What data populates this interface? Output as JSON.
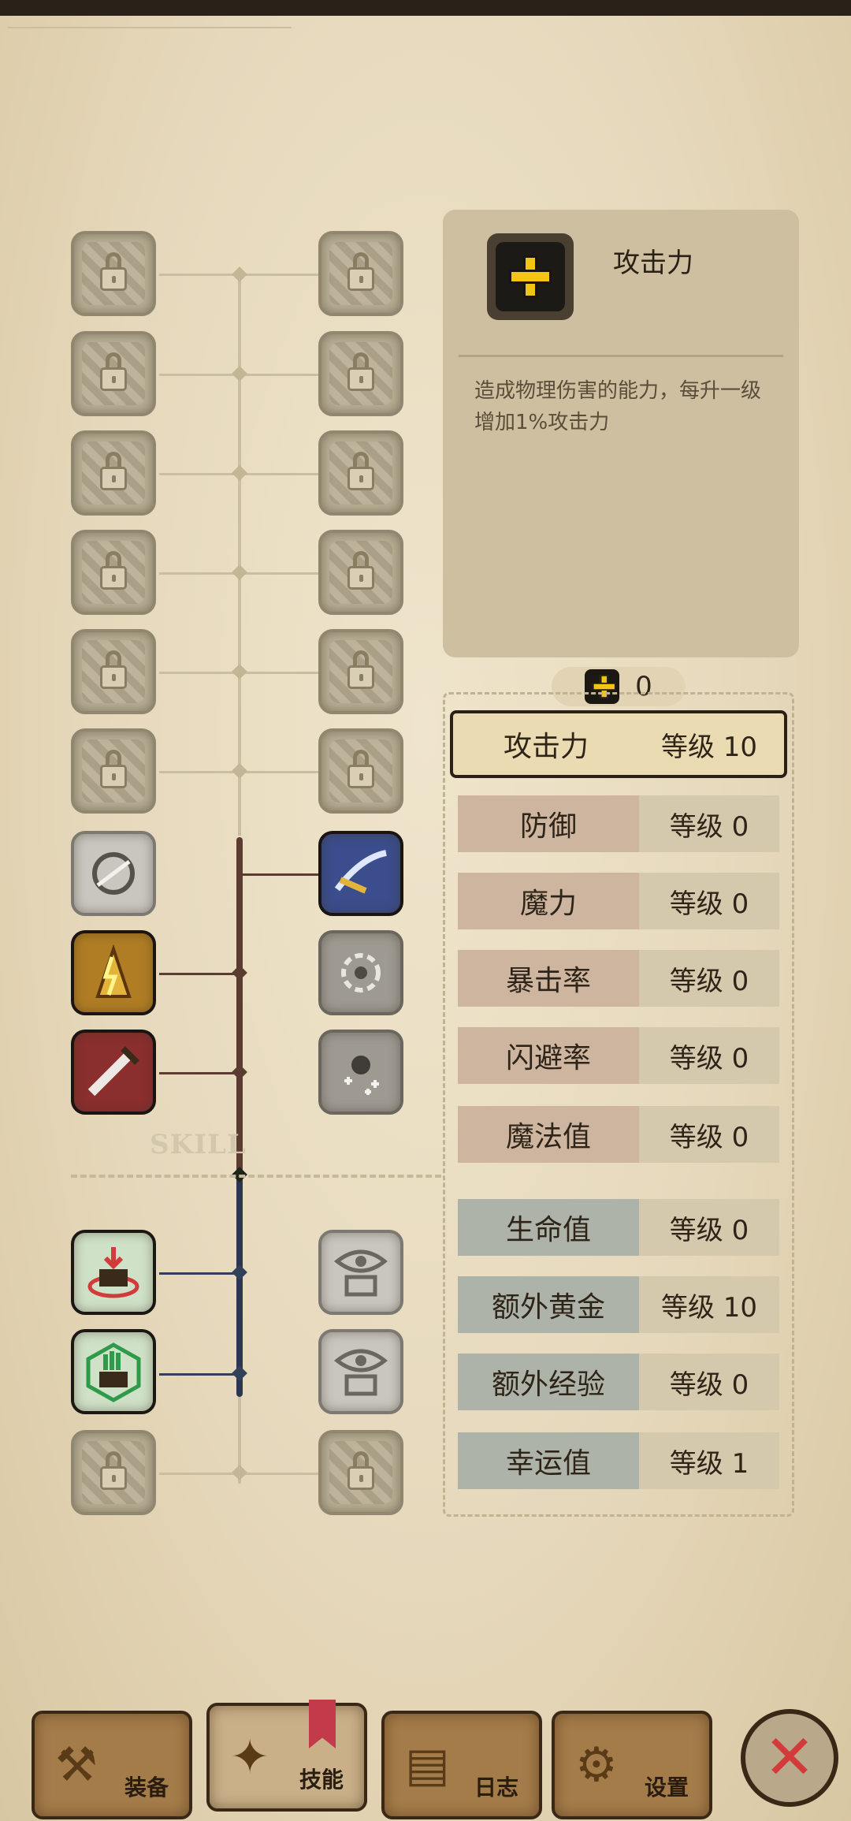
{
  "info_panel": {
    "title": "攻击力",
    "icon": "plus-icon",
    "description": "造成物理伤害的能力，每升一级增加1%攻击力"
  },
  "skill_points": {
    "icon": "plus-icon",
    "value": "0"
  },
  "tree": {
    "label": "SKILL",
    "left_slots": [
      "locked",
      "locked",
      "locked",
      "locked",
      "locked",
      "locked",
      "gray-skill",
      "gold-skill",
      "red-sword-skill",
      "red-chest-skill",
      "green-chest-skill",
      "locked"
    ],
    "right_slots": [
      "locked",
      "locked",
      "locked",
      "locked",
      "locked",
      "locked",
      "blue-skill",
      "gray-orb-skill",
      "gray-sparkle-skill",
      "eye-chest-skill",
      "eye-chest-skill",
      "locked"
    ]
  },
  "stats": [
    {
      "name": "攻击力",
      "level": "等级 10",
      "selected": true
    },
    {
      "name": "防御",
      "level": "等级 0"
    },
    {
      "name": "魔力",
      "level": "等级 0"
    },
    {
      "name": "暴击率",
      "level": "等级 0"
    },
    {
      "name": "闪避率",
      "level": "等级 0"
    },
    {
      "name": "魔法值",
      "level": "等级 0"
    },
    {
      "name": "生命值",
      "level": "等级 0"
    },
    {
      "name": "额外黄金",
      "level": "等级 10"
    },
    {
      "name": "额外经验",
      "level": "等级 0"
    },
    {
      "name": "幸运值",
      "level": "等级 1"
    }
  ],
  "tabs": [
    {
      "label": "装备",
      "icon": "axe-icon"
    },
    {
      "label": "技能",
      "icon": "skill-icon",
      "active": true
    },
    {
      "label": "日志",
      "icon": "book-icon"
    },
    {
      "label": "设置",
      "icon": "gear-icon"
    }
  ],
  "close": {
    "icon": "close-icon",
    "glyph": "✕"
  }
}
